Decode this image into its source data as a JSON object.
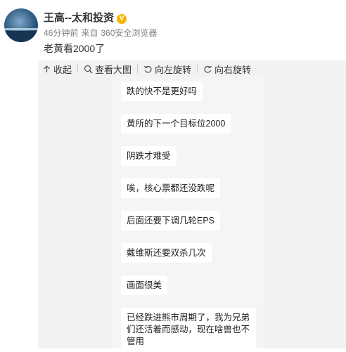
{
  "post": {
    "username": "王高--太和投资",
    "verified_badge": "V",
    "time": "46分钟前",
    "source_prefix": "来自",
    "source": "360安全浏览器",
    "text": "老黄看2000了"
  },
  "toolbar": {
    "collapse": "收起",
    "view_large": "查看大图",
    "rotate_left": "向左旋转",
    "rotate_right": "向右旋转"
  },
  "image": {
    "messages": [
      "跌的快不是更好吗",
      "黄所的下一个目标位2000",
      "阴跌才难受",
      "唉，核心票都还没跌呢",
      "后面还要下调几轮EPS",
      "戴维斯还要双杀几次",
      "画面很美",
      "已经跌进熊市周期了，我为兄弟们还活着而感动，现在啥兽也不管用"
    ]
  },
  "icons": [
    "collapse-arrow-icon",
    "magnifier-icon",
    "rotate-left-icon",
    "rotate-right-icon",
    "verified-v-icon"
  ],
  "colors": {
    "verified": "#f7b500",
    "panel_bg": "#f2f2f5",
    "meta_text": "#808080"
  }
}
